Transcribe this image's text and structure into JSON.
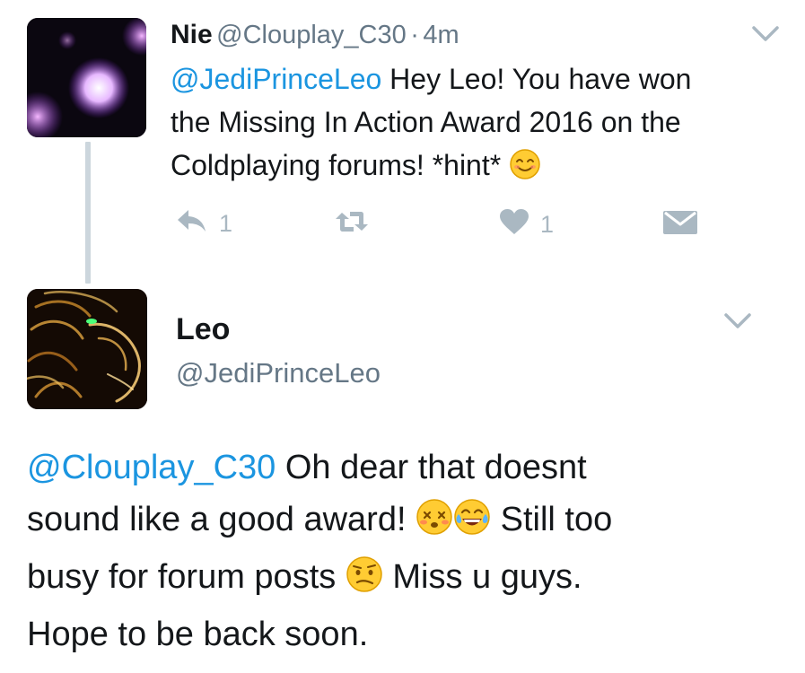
{
  "tweet1": {
    "author_name": "Nie",
    "author_handle": "@Clouplay_C30",
    "separator": "·",
    "timestamp": "4m",
    "mention": "@JediPrinceLeo",
    "text_line1": " Hey Leo! You have won",
    "text_line2": "the Missing In Action Award 2016 on the",
    "text_line3": "Coldplaying forums! *hint* ",
    "emoji_1": "smiling-face-with-smiling-eyes",
    "reply_count": "1",
    "like_count": "1"
  },
  "tweet2": {
    "author_name": "Leo",
    "author_handle": "@JediPrinceLeo",
    "mention": "@Clouplay_C30",
    "text_line1": " Oh dear that doesnt",
    "text_line2a": "sound like a good award! ",
    "text_line2b": " Still too",
    "text_line3a": "busy for forum posts ",
    "text_line3b": " Miss u guys.",
    "text_line4": "Hope to be back soon.",
    "emoji_1": "dizzy-face",
    "emoji_2": "face-with-tears-of-joy",
    "emoji_3": "confused-face"
  },
  "colors": {
    "link": "#1b95e0",
    "secondary_text": "#657786",
    "action_icon": "#aab8c2",
    "thread_line": "#ccd6dd"
  }
}
